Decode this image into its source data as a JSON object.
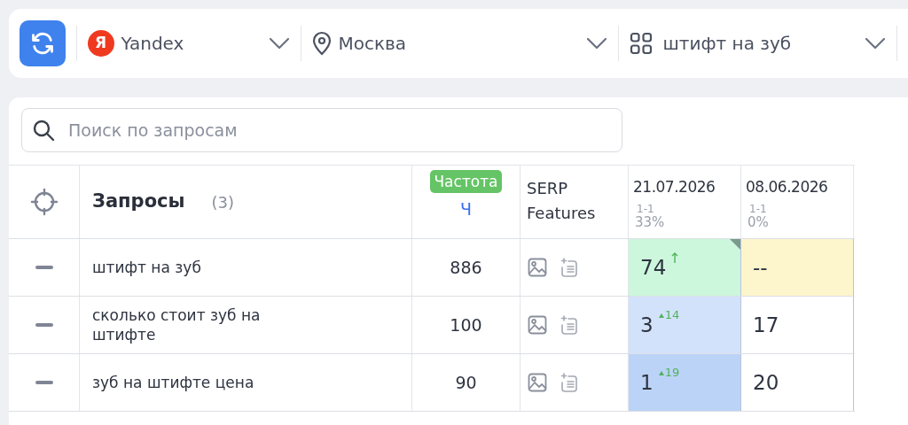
{
  "toolbar": {
    "engine": {
      "logo_letter": "Я",
      "label": "Yandex"
    },
    "region": {
      "label": "Москва"
    },
    "group": {
      "label": "штифт на зуб"
    }
  },
  "search": {
    "placeholder": "Поиск по запросам"
  },
  "table": {
    "header": {
      "title": "Запросы",
      "count": "(3)",
      "frequency_badge": "Частота",
      "frequency_type": "Ч",
      "serp": "SERP Features",
      "dates": [
        {
          "date": "21.07.2026",
          "range": "1-1",
          "percent": "33%"
        },
        {
          "date": "08.06.2026",
          "range": "1-1",
          "percent": "0%"
        }
      ]
    },
    "rows": [
      {
        "query": "штифт на зуб",
        "frequency": "886",
        "positions": [
          {
            "value": "74",
            "color": "#ccf7dc",
            "flagged": true,
            "kind": "arrow"
          },
          {
            "value": "--",
            "color": "#fdf5cc",
            "flagged": false,
            "kind": "plain"
          }
        ]
      },
      {
        "query": "сколько стоит зуб на штифте",
        "frequency": "100",
        "positions": [
          {
            "value": "3",
            "color": "#d3e2fb",
            "flagged": false,
            "kind": "triangle",
            "change": "14"
          },
          {
            "value": "17",
            "color": "#ffffff",
            "flagged": false,
            "kind": "plain"
          }
        ]
      },
      {
        "query": "зуб на штифте цена",
        "frequency": "90",
        "positions": [
          {
            "value": "1",
            "color": "#bcd3f8",
            "flagged": false,
            "kind": "triangle",
            "change": "19"
          },
          {
            "value": "20",
            "color": "#ffffff",
            "flagged": false,
            "kind": "plain"
          }
        ]
      }
    ]
  }
}
